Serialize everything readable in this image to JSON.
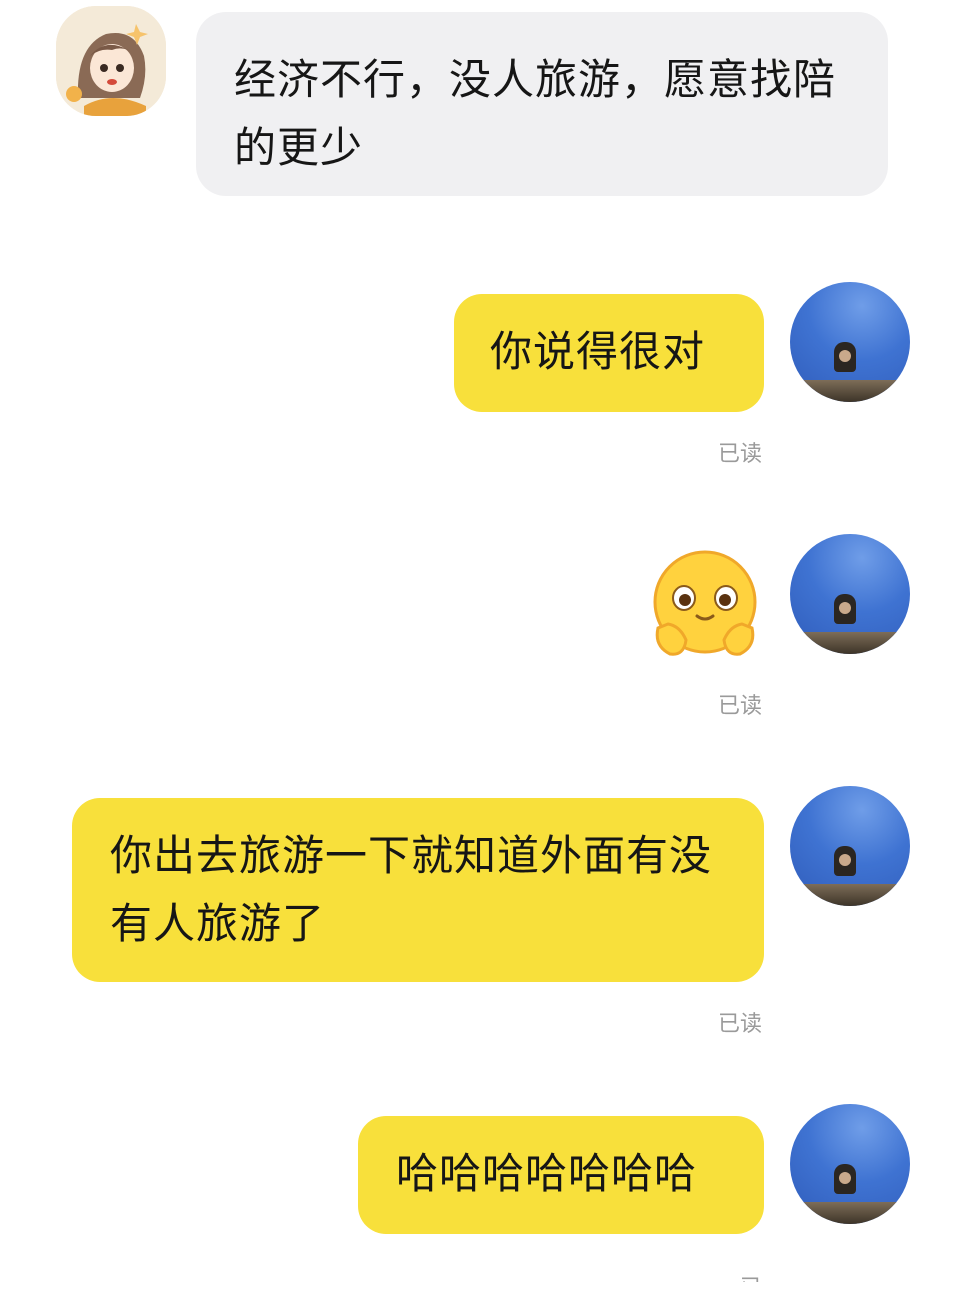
{
  "chat": {
    "messages": [
      {
        "sender": "other",
        "type": "text",
        "text": "经济不行，没人旅游，愿意找陪的更少"
      },
      {
        "sender": "self",
        "type": "text",
        "text": "你说得很对",
        "status": "已读"
      },
      {
        "sender": "self",
        "type": "sticker",
        "sticker": "hug-face-emoji",
        "status": "已读"
      },
      {
        "sender": "self",
        "type": "text",
        "text": "你出去旅游一下就知道外面有没有人旅游了",
        "status": "已读"
      },
      {
        "sender": "self",
        "type": "text",
        "text": "哈哈哈哈哈哈哈",
        "status": "已"
      }
    ]
  },
  "colors": {
    "other_bubble": "#f0f0f2",
    "self_bubble": "#f8e03b",
    "read_status": "#9a9a9a"
  },
  "icons": {
    "other_avatar": "anime-character-avatar",
    "self_avatar": "blue-sky-portrait-avatar",
    "sticker": "hug-face-emoji"
  }
}
